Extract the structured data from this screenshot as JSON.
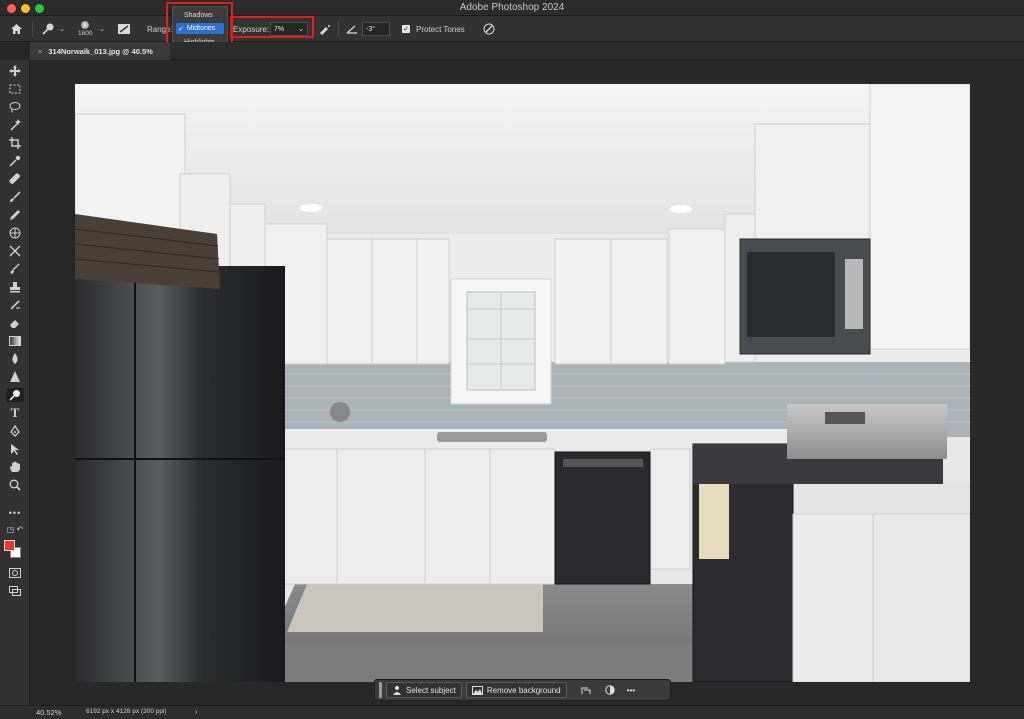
{
  "app": {
    "title": "Adobe Photoshop 2024"
  },
  "options_bar": {
    "brush_size": "1600",
    "range_label": "Range:",
    "range_options": [
      "Shadows",
      "Midtones",
      "Highlights"
    ],
    "range_selected_index": 1,
    "exposure_label": "Exposure:",
    "exposure_value": "7%",
    "angle_value": "-3°",
    "protect_tones_label": "Protect Tones",
    "protect_tones_checked": true
  },
  "document": {
    "tab_title": "314Norwalk_013.jpg @ 40.5%"
  },
  "context_bar": {
    "select_subject_label": "Select subject",
    "remove_background_label": "Remove background",
    "more_label": "•••"
  },
  "status_bar": {
    "zoom": "40.52%",
    "doc_info": "6192 px x 4128 px (300 ppi)",
    "arrow": "›"
  },
  "colors": {
    "foreground": "#e3382b",
    "background": "#ffffff",
    "highlight_box": "#e01e1e",
    "accent": "#2f6fd0"
  },
  "toolbar": {
    "tools": [
      "move-icon",
      "marquee-icon",
      "lasso-icon",
      "magic-wand-icon",
      "crop-icon",
      "eyedropper-icon",
      "healing-brush-icon",
      "brush-icon",
      "clone-stamp-icon",
      "history-brush-icon",
      "eraser-icon",
      "gradient-icon",
      "blur-icon",
      "dodge-icon",
      "pen-icon",
      "type-icon",
      "path-selection-icon",
      "hand-icon",
      "zoom-icon",
      "more-tools-icon"
    ]
  }
}
